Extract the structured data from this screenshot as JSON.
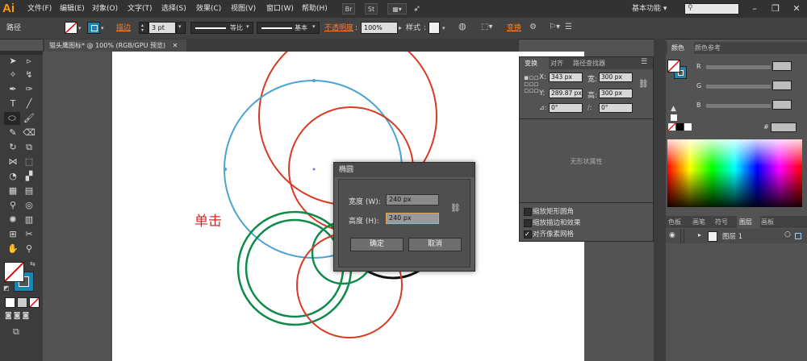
{
  "app": {
    "logo": "Ai",
    "workspace": "基本功能",
    "workspace_arrow": "▾"
  },
  "menu": [
    "文件(F)",
    "编辑(E)",
    "对象(O)",
    "文字(T)",
    "选择(S)",
    "效果(C)",
    "视图(V)",
    "窗口(W)",
    "帮助(H)"
  ],
  "menubar_buttons": {
    "br": "Br",
    "st": "St"
  },
  "window_controls": {
    "minimize": "–",
    "restore": "❐",
    "close": "✕"
  },
  "controlbar": {
    "object_type": "路径",
    "stroke_label": "描边",
    "stroke_value": "3 pt",
    "profile_label": "等比",
    "brush_label": "基本",
    "opacity_label": "不透明度",
    "opacity_value": "100%",
    "style_label": "样式",
    "transform_label": "变换"
  },
  "document_tab": {
    "title": "猫头鹰图标* @ 100% (RGB/GPU 预览)",
    "close": "✕"
  },
  "canvas": {
    "annotation": "单击"
  },
  "dialog": {
    "title": "椭圆",
    "width_label": "宽度 (W):",
    "width_value": "240 px",
    "height_label": "高度 (H):",
    "height_value": "240 px",
    "ok_label": "确定",
    "cancel_label": "取消"
  },
  "transform_panel": {
    "tabs": [
      "变换",
      "对齐",
      "路径查找器"
    ],
    "x_label": "X:",
    "x_value": "343 px",
    "w_label": "宽:",
    "w_value": "300 px",
    "y_label": "Y:",
    "y_value": "289.87 px",
    "h_label": "高:",
    "h_value": "300 px",
    "rotate_value": "0°",
    "shear_value": "0°",
    "no_shape_props": "无形状属性",
    "options": [
      {
        "label": "缩放矩形圆角",
        "checked": false
      },
      {
        "label": "缩放描边和效果",
        "checked": false
      },
      {
        "label": "对齐像素网格",
        "checked": true
      }
    ]
  },
  "color_panel": {
    "tabs": [
      "颜色",
      "颜色参考"
    ],
    "channels": [
      "R",
      "G",
      "B"
    ],
    "hex_prefix": "#"
  },
  "layers_panel": {
    "tabs": [
      "色板",
      "画笔",
      "符号",
      "图层",
      "画板"
    ],
    "layers": [
      {
        "name": "图层 1"
      }
    ]
  },
  "colors": {
    "red_circle": "#d93a23",
    "blue_circle": "#4aa3d0",
    "green_circle": "#0f8a4a",
    "black_circle": "#111111",
    "accent_orange": "#ff7f27",
    "annotation_red": "#d12a2a"
  }
}
